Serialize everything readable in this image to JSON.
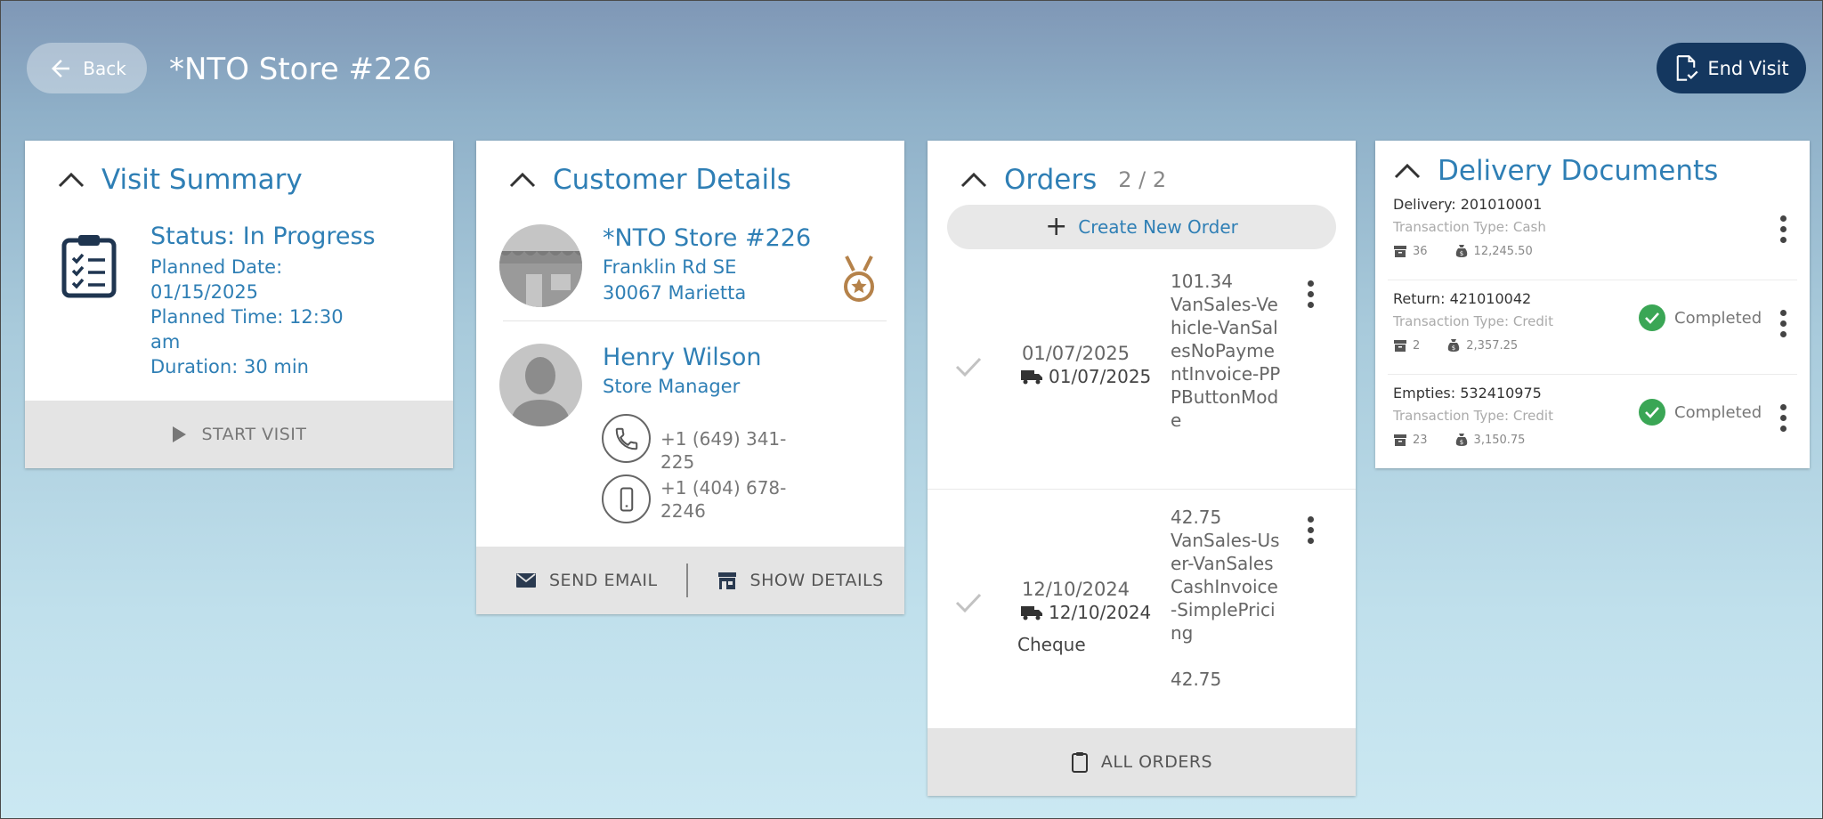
{
  "header": {
    "back_label": "Back",
    "store_title": "*NTO Store #226",
    "end_visit_label": "End Visit"
  },
  "visit_summary": {
    "title": "Visit Summary",
    "status": "Status: In Progress",
    "planned_date": "Planned Date: 01/15/2025",
    "planned_time": "Planned Time: 12:30 am",
    "duration": "Duration: 30 min",
    "start_label": "START VISIT"
  },
  "customer": {
    "title": "Customer Details",
    "store_name": "*NTO Store #226",
    "street": "Franklin Rd SE",
    "city": "30067 Marietta",
    "contact_name": "Henry Wilson",
    "contact_role": "Store Manager",
    "phone": "+1 (649) 341-225",
    "mobile": "+1 (404) 678-2246",
    "send_email_label": "SEND EMAIL",
    "show_details_label": "SHOW DETAILS"
  },
  "orders": {
    "title": "Orders",
    "count": "2 / 2",
    "create_label": "Create New Order",
    "all_orders_label": "ALL ORDERS",
    "items": [
      {
        "order_date": "01/07/2025",
        "delivery_date": "01/07/2025",
        "payment": "",
        "amount": "101.34",
        "description": "VanSales-Vehicle-VanSalesNoPaymentInvoice-PPPButtonMode",
        "amount_after": ""
      },
      {
        "order_date": "12/10/2024",
        "delivery_date": "12/10/2024",
        "payment": "Cheque",
        "amount": "42.75",
        "description": "VanSales-User-VanSalesCashInvoice-SimplePricing",
        "amount_after": "42.75"
      }
    ]
  },
  "delivery_documents": {
    "title": "Delivery Documents",
    "items": [
      {
        "title": "Delivery: 201010001",
        "type": "Transaction Type: Cash",
        "qty": "36",
        "value": "12,245.50",
        "status": ""
      },
      {
        "title": "Return: 421010042",
        "type": "Transaction Type: Credit",
        "qty": "2",
        "value": "2,357.25",
        "status": "Completed"
      },
      {
        "title": "Empties: 532410975",
        "type": "Transaction Type: Credit",
        "qty": "23",
        "value": "3,150.75",
        "status": "Completed"
      }
    ]
  },
  "colors": {
    "accent": "#2f7fb5",
    "end_visit_bg": "#14375f",
    "success": "#3aa655"
  }
}
